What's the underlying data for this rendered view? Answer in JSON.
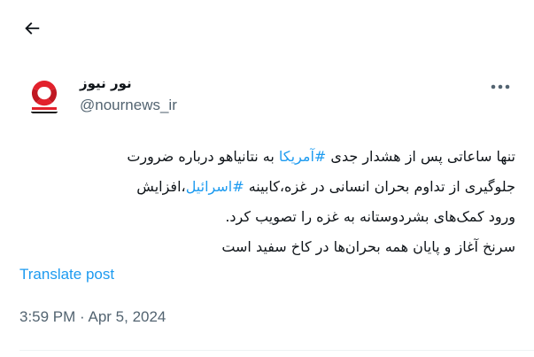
{
  "nav": {
    "back_icon": "arrow-left-icon"
  },
  "author": {
    "display_name": "نور نیوز",
    "handle": "@nournews_ir",
    "avatar_text": "NOURNEWS",
    "avatar_colors": {
      "red": "#e2212c",
      "dark": "#1a1a1a"
    }
  },
  "more_icon": "more-dots-icon",
  "tweet": {
    "line1_part1": "تنها ساعاتی پس از هشدار جدی ",
    "line1_hashtag": "#آمریکا",
    "line1_part2": " به نتانیاهو درباره ضرورت",
    "line2_part1": "جلوگیری از تداوم بحران انسانی در غزه،کابینه ",
    "line2_hashtag": "#اسرائیل",
    "line2_part2": "،افزایش",
    "line3": "ورود کمک‌های بشردوستانه به غزه را تصویب کرد.",
    "line4": "سرنخ آغاز و پایان همه بحران‌ها در کاخ سفید است"
  },
  "translate_label": "Translate post",
  "timestamp": {
    "time": "3:59 PM",
    "separator": " · ",
    "date": "Apr 5, 2024"
  },
  "colors": {
    "link": "#1d9bf0",
    "text": "#0f1419",
    "secondary": "#536471"
  }
}
